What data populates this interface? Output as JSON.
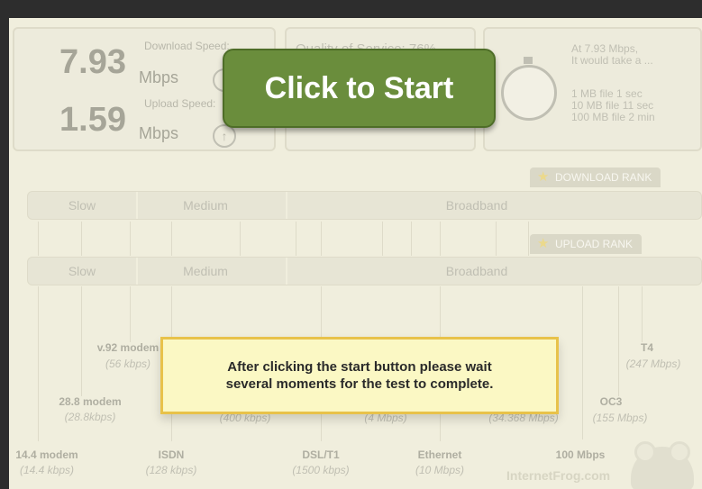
{
  "download": {
    "value": "7.93",
    "unit": "Mbps",
    "label": "Download Speed:"
  },
  "upload": {
    "value": "1.59",
    "unit": "Mbps",
    "label": "Upload Speed:"
  },
  "qos": {
    "label": "Quality of Service:",
    "value": "76%"
  },
  "estimate": {
    "line1": "At 7.93 Mbps,",
    "line2": "It would take a ...",
    "line3": "1 MB file 1 sec",
    "line4": "10 MB file 11 sec",
    "line5": "100 MB file 2 min"
  },
  "rank": {
    "download_label": "DOWNLOAD RANK",
    "upload_label": "UPLOAD RANK"
  },
  "bands": {
    "slow": "Slow",
    "medium": "Medium",
    "broadband": "Broadband"
  },
  "connections": [
    {
      "name": "14.4 modem",
      "speed": "(14.4 kbps)"
    },
    {
      "name": "28.8 modem",
      "speed": "(28.8kbps)"
    },
    {
      "name": "v.92 modem",
      "speed": "(56 kbps)"
    },
    {
      "name": "ISDN",
      "speed": "(128 kbps)"
    },
    {
      "name": "",
      "speed": "(400 kbps)"
    },
    {
      "name": "DSL/T1",
      "speed": "(1500 kbps)"
    },
    {
      "name": "",
      "speed": "(4 Mbps)"
    },
    {
      "name": "Ethernet",
      "speed": "(10 Mbps)"
    },
    {
      "name": "",
      "speed": "(34.368 Mbps)"
    },
    {
      "name": "100 Mbps",
      "speed": ""
    },
    {
      "name": "OC3",
      "speed": "(155 Mbps)"
    },
    {
      "name": "T4",
      "speed": "(247 Mbps)"
    }
  ],
  "logo": "InternetFrog.com",
  "start_button": "Click to Start",
  "notice": {
    "line1": "After clicking the start button please wait",
    "line2": "several moments for the test to complete."
  },
  "colors": {
    "button": "#6a8d3c",
    "notice_bg": "#fbf8c4",
    "notice_border": "#e8c24a"
  }
}
